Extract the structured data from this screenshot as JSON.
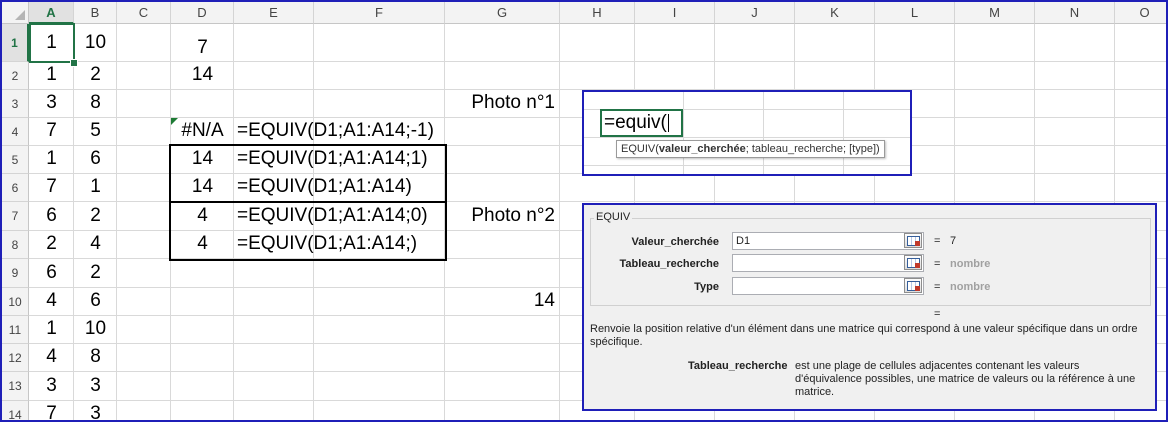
{
  "columns": [
    "A",
    "B",
    "C",
    "D",
    "E",
    "F",
    "G",
    "H",
    "I",
    "J",
    "K",
    "L",
    "M",
    "N",
    "O"
  ],
  "rows": [
    "1",
    "2",
    "3",
    "4",
    "5",
    "6",
    "7",
    "8",
    "9",
    "10",
    "11",
    "12",
    "13",
    "14"
  ],
  "col_a": [
    "1",
    "1",
    "3",
    "7",
    "1",
    "7",
    "6",
    "2",
    "6",
    "4",
    "1",
    "4",
    "3",
    "7"
  ],
  "col_b": [
    "10",
    "2",
    "8",
    "5",
    "6",
    "1",
    "2",
    "4",
    "2",
    "6",
    "10",
    "8",
    "3",
    "3"
  ],
  "col_d": {
    "d1": "7",
    "d2": "14",
    "d4": "#N/A",
    "d5": "14",
    "d6": "14",
    "d7": "4",
    "d8": "4"
  },
  "formulas": {
    "e4": "=EQUIV(D1;A1:A14;-1)",
    "e5": "=EQUIV(D1;A1:A14;1)",
    "e6": "=EQUIV(D1;A1:A14)",
    "e7": "=EQUIV(D1;A1:A14;0)",
    "e8": "=EQUIV(D1;A1:A14;)"
  },
  "labels": {
    "photo1": "Photo n°1",
    "photo2": "Photo n°2",
    "g10": "14"
  },
  "photo1": {
    "editing_text": "=equiv(",
    "tooltip_fn": "EQUIV(",
    "tooltip_arg1": "valeur_cherchée",
    "tooltip_rest": "; tableau_recherche; [type])"
  },
  "dialog": {
    "group_title": "EQUIV",
    "args": [
      {
        "label": "Valeur_cherchée",
        "value": "D1",
        "result": "7"
      },
      {
        "label": "Tableau_recherche",
        "value": "",
        "result": "nombre"
      },
      {
        "label": "Type",
        "value": "",
        "result": "nombre"
      }
    ],
    "eq": "=",
    "final_eq": "=",
    "description": "Renvoie la position relative d'un élément dans une matrice qui correspond à une valeur spécifique dans un ordre spécifique.",
    "arg_name": "Tableau_recherche",
    "arg_help": "est une plage de cellules adjacentes contenant les valeurs d'équivalence possibles, une matrice de valeurs ou la référence à une matrice."
  }
}
